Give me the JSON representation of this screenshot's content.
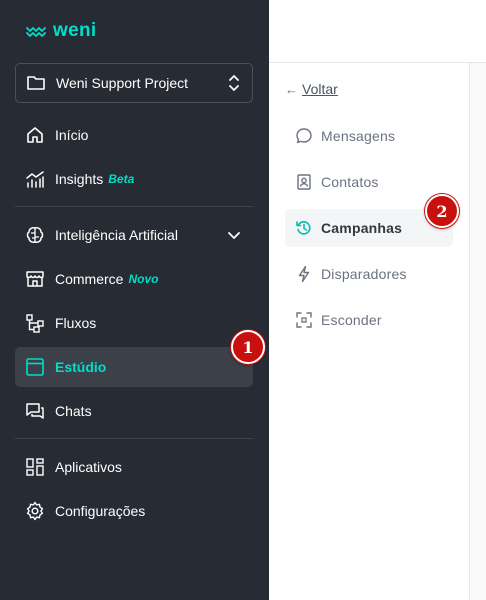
{
  "brand": {
    "logo_text": "weni",
    "accent": "#00dec9"
  },
  "project": {
    "name": "Weni Support Project"
  },
  "sidebar": {
    "items": [
      {
        "label": "Início",
        "icon": "home-icon"
      },
      {
        "label": "Insights",
        "tag": "Beta",
        "icon": "insights-chart-icon"
      },
      {
        "label": "Inteligência Artificial",
        "icon": "brain-icon",
        "expandable": true
      },
      {
        "label": "Commerce",
        "tag": "Novo",
        "icon": "store-icon"
      },
      {
        "label": "Fluxos",
        "icon": "flows-icon"
      },
      {
        "label": "Estúdio",
        "icon": "studio-window-icon",
        "active": true
      },
      {
        "label": "Chats",
        "icon": "chats-icon"
      },
      {
        "label": "Aplicativos",
        "icon": "apps-grid-icon"
      },
      {
        "label": "Configurações",
        "icon": "gear-icon"
      }
    ]
  },
  "submenu": {
    "back_label": "Voltar",
    "back_arrow": "←",
    "items": [
      {
        "label": "Mensagens",
        "icon": "message-bubble-icon"
      },
      {
        "label": "Contatos",
        "icon": "contact-card-icon"
      },
      {
        "label": "Campanhas",
        "icon": "history-clock-icon",
        "active": true
      },
      {
        "label": "Disparadores",
        "icon": "bolt-icon"
      },
      {
        "label": "Esconder",
        "icon": "hide-frame-icon"
      }
    ]
  },
  "annotations": {
    "step1": "1",
    "step2": "2"
  }
}
